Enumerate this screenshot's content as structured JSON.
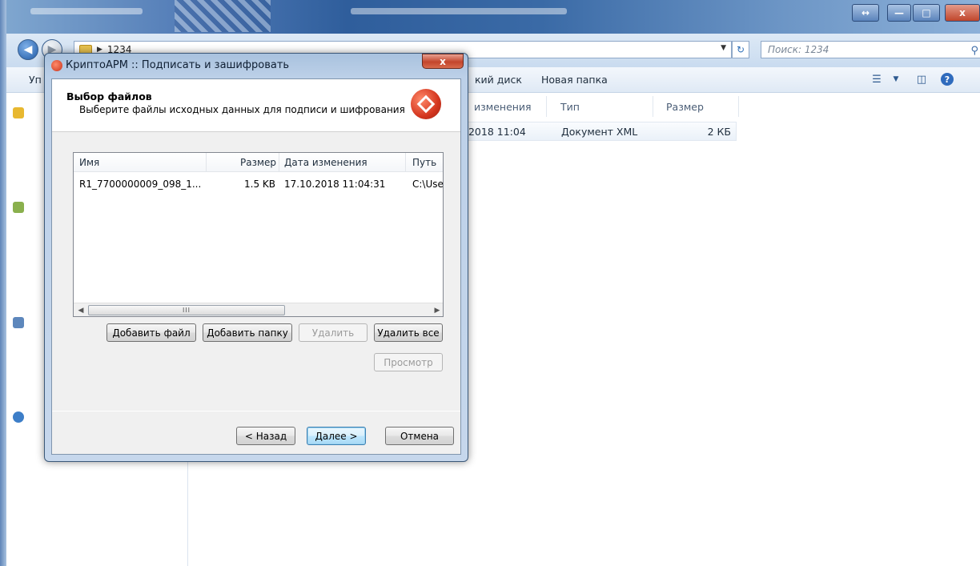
{
  "explorer": {
    "path_label": "1234",
    "search_placeholder": "Поиск: 1234",
    "toolbar_left": "Уп",
    "toolbar_partial": "кий диск",
    "toolbar_new_folder": "Новая папка",
    "columns": {
      "modified_partial": "изменения",
      "type": "Тип",
      "size": "Размер"
    },
    "file_row": {
      "modified_partial": ".2018 11:04",
      "type": "Документ XML",
      "size": "2 КБ"
    }
  },
  "dialog": {
    "title": "КриптоАРМ :: Подписать и зашифровать",
    "close_label": "x",
    "header_title": "Выбор файлов",
    "header_subtitle": "Выберите файлы исходных данных для подписи и шифрования",
    "list": {
      "columns": [
        "Имя",
        "Размер",
        "Дата изменения",
        "Путь"
      ],
      "rows": [
        {
          "name": "R1_7700000009_098_1...",
          "size": "1.5 KB",
          "date": "17.10.2018 11:04:31",
          "path": "C:\\Use"
        }
      ],
      "scroll_thumb_label": "III"
    },
    "buttons": {
      "add_file": "Добавить файл",
      "add_folder": "Добавить папку",
      "remove": "Удалить",
      "remove_all": "Удалить все",
      "preview": "Просмотр",
      "back": "< Назад",
      "next": "Далее >",
      "cancel": "Отмена"
    }
  }
}
